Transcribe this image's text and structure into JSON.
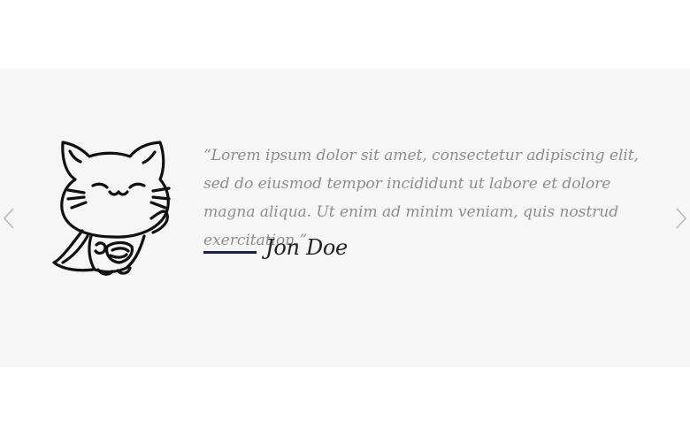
{
  "testimonial": {
    "quote": "“Lorem ipsum dolor sit amet, consectetur adipiscing elit, sed do eiusmod tempor incididunt ut labore et dolore magna aliqua. Ut enim ad minim veniam, quis nostrud exercitation.”",
    "author": "Jon Doe",
    "avatar_icon": "superhero-cat-icon"
  },
  "carousel": {
    "prev_icon": "chevron-left-icon",
    "next_icon": "chevron-right-icon"
  },
  "colors": {
    "band_background": "#f6f6f6",
    "quote_text": "#8e8e8e",
    "author_line": "#1b2050",
    "arrow": "#b9b9b9"
  }
}
